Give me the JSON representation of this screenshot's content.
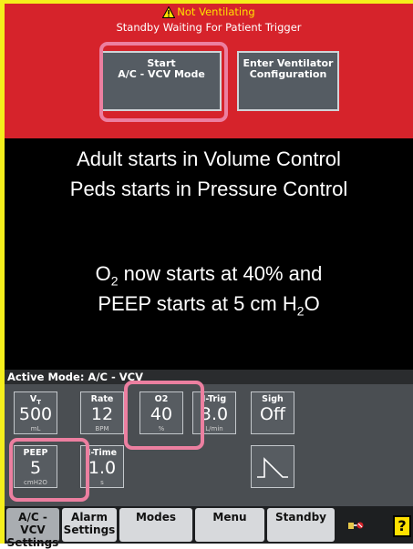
{
  "header": {
    "alarm_text": "Not Ventilating",
    "status_text": "Standby Waiting For Patient Trigger",
    "start_button": {
      "line1": "Start",
      "line2": "A/C - VCV Mode"
    },
    "config_button": {
      "line1": "Enter Ventilator",
      "line2": "Configuration"
    }
  },
  "message": {
    "line1": "Adult starts in Volume Control",
    "line2": "Peds starts in Pressure Control",
    "line3_pre": "O",
    "line3_sub": "2",
    "line3_post": " now starts at 40% and",
    "line4_pre": "PEEP starts at 5 cm H",
    "line4_sub": "2",
    "line4_post": "O"
  },
  "panel": {
    "active_mode": "Active Mode: A/C - VCV",
    "tiles": [
      {
        "label_main": "V",
        "label_sub": "T",
        "value": "500",
        "unit": "mL"
      },
      {
        "label": "Rate",
        "value": "12",
        "unit": "BPM"
      },
      {
        "label": "O2",
        "value": "40",
        "unit": "%"
      },
      {
        "label": "I-Trig",
        "value": "3.0",
        "unit": "L/min"
      },
      {
        "label": "Sigh",
        "value": "Off",
        "unit": ""
      },
      {
        "label": "PEEP",
        "value": "5",
        "unit": "cmH2O"
      },
      {
        "label": "I-Time",
        "value": "1.0",
        "unit": "s"
      }
    ]
  },
  "tabs": [
    {
      "line1": "A/C - VCV",
      "line2": "Settings"
    },
    {
      "line1": "Alarm",
      "line2": "Settings"
    },
    {
      "line1": "Modes",
      "line2": ""
    },
    {
      "line1": "Menu",
      "line2": ""
    },
    {
      "line1": "Standby",
      "line2": ""
    }
  ],
  "help_label": "?",
  "colors": {
    "header_red": "#d6232b",
    "highlight_pink": "#ec7fa0",
    "alarm_yellow": "#ffe000"
  }
}
